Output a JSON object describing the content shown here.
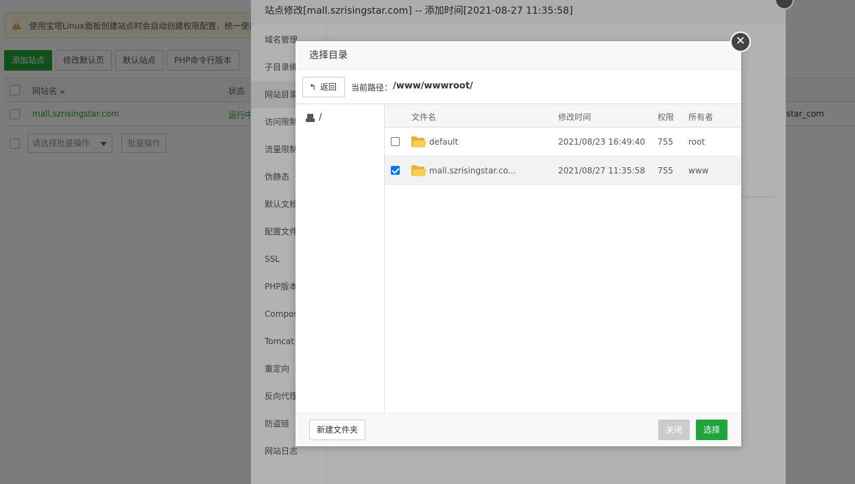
{
  "background": {
    "notice_text": "使用宝塔Linux面板创建站点时会自动创建权限配置，统一使用",
    "toolbar": [
      "添加站点",
      "修改默认页",
      "默认站点",
      "PHP命令行版本"
    ],
    "table_headers": {
      "name": "网站名",
      "status": "状态"
    },
    "rows": [
      {
        "name": "mall.szrisingstar.com",
        "status": "运行中",
        "owner_tail": "star_com"
      }
    ],
    "batch_placeholder": "请选择批量操作",
    "batch_button": "批量操作"
  },
  "site_layer": {
    "title": "站点修改[mall.szrisingstar.com] -- 添加时间[2021-08-27 11:35:58]",
    "menu": [
      "域名管理",
      "子目录绑定",
      "网站目录",
      "访问限制",
      "流量限制",
      "伪静态",
      "默认文档",
      "配置文件",
      "SSL",
      "PHP版本",
      "Composer",
      "Tomcat",
      "重定向",
      "反向代理",
      "防盗链",
      "网站日志"
    ],
    "active_menu": "网站目录"
  },
  "dialog": {
    "title": "选择目录",
    "close_glyph": "✕",
    "back_label": "返回",
    "back_icon": "arrow-back-icon",
    "path_label": "当前路径：",
    "path_value": "/www/wwwroot/",
    "tree_root": "/",
    "columns": {
      "name": "文件名",
      "time": "修改时间",
      "perm": "权限",
      "owner": "所有者"
    },
    "files": [
      {
        "name": "default",
        "time": "2021/08/23 16:49:40",
        "perm": "755",
        "owner": "root",
        "checked": false
      },
      {
        "name": "mall.szrisingstar.co...",
        "time": "2021/08/27 11:35:58",
        "perm": "755",
        "owner": "www",
        "checked": true
      }
    ],
    "new_folder_label": "新建文件夹",
    "close_label": "关闭",
    "choose_label": "选择"
  },
  "colors": {
    "primary_green": "#20a53a",
    "folder_yellow": "#f6cf5a",
    "checkbox_blue": "#0075ff"
  }
}
